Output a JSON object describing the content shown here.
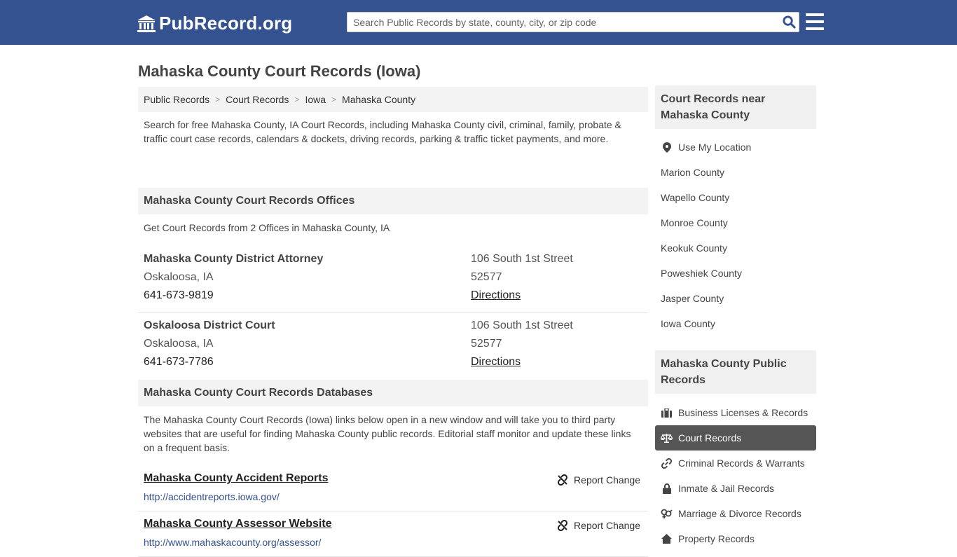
{
  "header": {
    "logo_text": "PubRecord.org",
    "search_placeholder": "Search Public Records by state, county, city, or zip code"
  },
  "page_title": "Mahaska County Court Records (Iowa)",
  "breadcrumbs": [
    "Public Records",
    "Court Records",
    "Iowa",
    "Mahaska County"
  ],
  "intro": "Search for free Mahaska County, IA Court Records, including Mahaska County civil, criminal, family, probate & traffic court case records, calendars & dockets, driving records, parking & traffic ticket payments, and more.",
  "offices": {
    "heading": "Mahaska County Court Records Offices",
    "subtext": "Get Court Records from 2 Offices in Mahaska County, IA",
    "items": [
      {
        "name": "Mahaska County District Attorney",
        "city": "Oskaloosa, IA",
        "phone": "641-673-9819",
        "street": "106 South 1st Street",
        "zip": "52577",
        "directions": "Directions"
      },
      {
        "name": "Oskaloosa District Court",
        "city": "Oskaloosa, IA",
        "phone": "641-673-7786",
        "street": "106 South 1st Street",
        "zip": "52577",
        "directions": "Directions"
      }
    ]
  },
  "databases": {
    "heading": "Mahaska County Court Records Databases",
    "text": "The Mahaska County Court Records (Iowa) links below open in a new window and will take you to third party websites that are useful for finding Mahaska County public records. Editorial staff monitor and update these links on a frequent basis.",
    "links": [
      {
        "title": "Mahaska County Accident Reports",
        "url": "http://accidentreports.iowa.gov/",
        "report": "Report Change"
      },
      {
        "title": "Mahaska County Assessor Website",
        "url": "http://www.mahaskacounty.org/assessor/",
        "report": "Report Change"
      }
    ]
  },
  "sidebar": {
    "nearby": {
      "heading": "Court Records near Mahaska County",
      "use_location": "Use My Location",
      "items": [
        "Marion County",
        "Wapello County",
        "Monroe County",
        "Keokuk County",
        "Poweshiek County",
        "Jasper County",
        "Iowa County"
      ]
    },
    "public": {
      "heading": "Mahaska County Public Records",
      "items": [
        {
          "label": "Business Licenses & Records",
          "icon": "briefcase-icon"
        },
        {
          "label": "Court Records",
          "icon": "scales-icon",
          "active": true
        },
        {
          "label": "Criminal Records & Warrants",
          "icon": "link-icon"
        },
        {
          "label": "Inmate & Jail Records",
          "icon": "lock-icon"
        },
        {
          "label": "Marriage & Divorce Records",
          "icon": "gender-icon"
        },
        {
          "label": "Property Records",
          "icon": "home-icon"
        }
      ]
    }
  },
  "colors": {
    "header_bg": "#34528f",
    "active_bg": "#555555",
    "link": "#34528f"
  }
}
